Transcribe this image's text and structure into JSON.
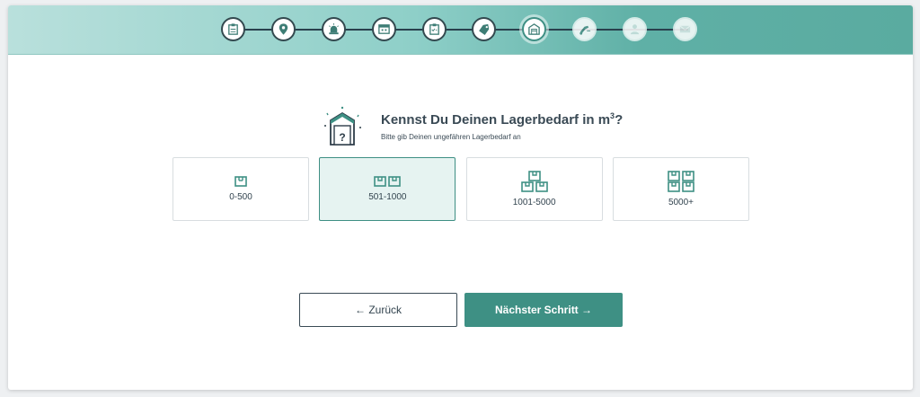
{
  "colors": {
    "accent": "#3e9084",
    "selected_bg": "#e6f3f1",
    "text": "#33444f"
  },
  "steps": [
    {
      "icon": "clipboard-icon",
      "state": "done"
    },
    {
      "icon": "location-pin-icon",
      "state": "done"
    },
    {
      "icon": "alarm-light-icon",
      "state": "done"
    },
    {
      "icon": "calendar-icon",
      "state": "done"
    },
    {
      "icon": "checklist-icon",
      "state": "done"
    },
    {
      "icon": "tag-icon",
      "state": "done"
    },
    {
      "icon": "warehouse-icon",
      "state": "active"
    },
    {
      "icon": "forklift-icon",
      "state": "future"
    },
    {
      "icon": "person-icon",
      "state": "future"
    },
    {
      "icon": "envelope-icon",
      "state": "future"
    }
  ],
  "question": {
    "title_main": "Kennst Du Deinen Lagerbedarf in m",
    "title_sup": "3",
    "title_end": "?",
    "subtitle": "Bitte gib Deinen ungefähren Lagerbedarf an",
    "illustration_mark": "?"
  },
  "options": [
    {
      "label": "0-500",
      "boxes": 1,
      "selected": false
    },
    {
      "label": "501-1000",
      "boxes": 2,
      "selected": true
    },
    {
      "label": "1001-5000",
      "boxes": 3,
      "selected": false
    },
    {
      "label": "5000+",
      "boxes": 4,
      "selected": false
    }
  ],
  "buttons": {
    "back": "← Zurück",
    "next": "Nächster Schritt →"
  }
}
